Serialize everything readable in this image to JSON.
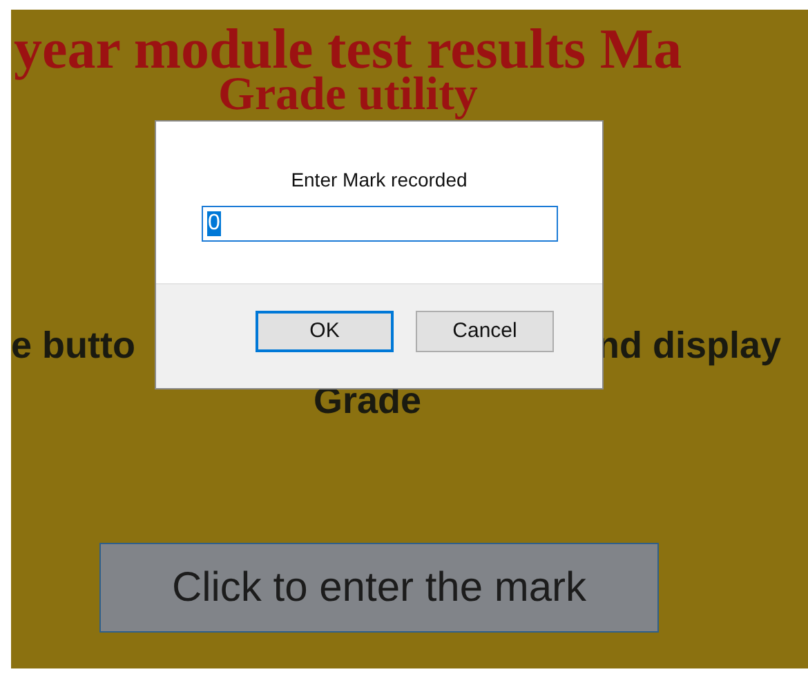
{
  "page": {
    "title_lines": [
      "year module test results Ma",
      "Grade utility"
    ],
    "instruction_left": "e butto",
    "instruction_right": "nd display",
    "instruction_line2": "Grade",
    "button": "Click to enter the mark"
  },
  "dialog": {
    "prompt": "Enter Mark recorded",
    "input": {
      "value": "0",
      "selected": true
    },
    "buttons": [
      {
        "label": "OK",
        "focused": true
      },
      {
        "label": "Cancel",
        "focused": false
      }
    ]
  }
}
